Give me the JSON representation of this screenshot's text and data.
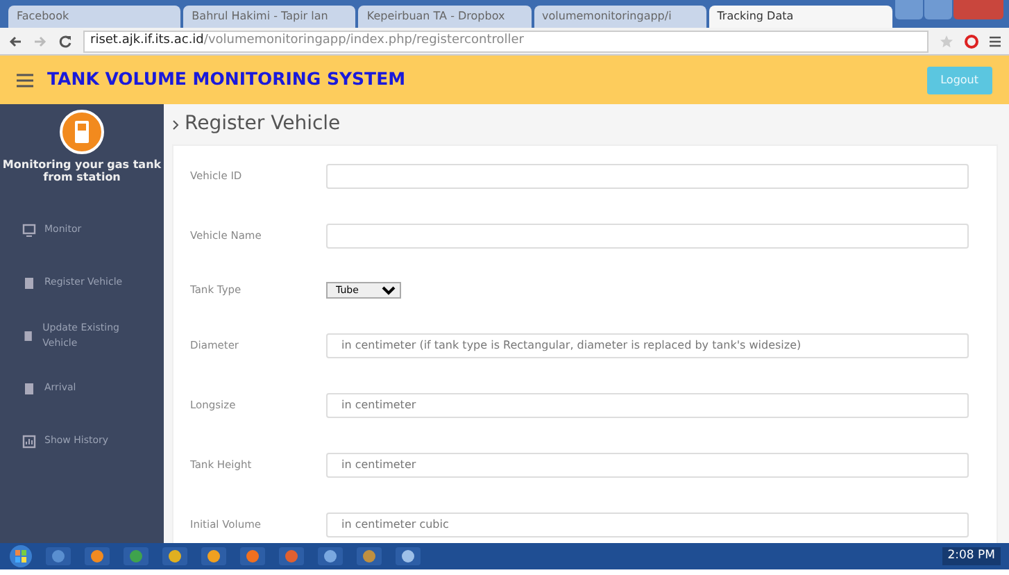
{
  "browser": {
    "tabs": [
      {
        "label": "Facebook",
        "selected": false
      },
      {
        "label": "Bahrul Hakimi - Tapir lan",
        "selected": false
      },
      {
        "label": "Kepeirbuan TA - Dropbox",
        "selected": false
      },
      {
        "label": "volumemonitoringapp/i",
        "selected": false
      },
      {
        "label": "Tracking Data",
        "selected": true
      }
    ],
    "url_host": "riset.ajk.if.its.ac.id",
    "url_path": "/volumemonitoringapp/index.php/registercontroller"
  },
  "navbar": {
    "title": "TANK VOLUME MONITORING SYSTEM",
    "button": "Logout"
  },
  "sidebar": {
    "tagline": "Monitoring your gas tank from station",
    "items": [
      {
        "label": "Monitor",
        "selected": false
      },
      {
        "label": "Register Vehicle",
        "selected": false
      },
      {
        "label": "Update Existing Vehicle",
        "selected": false
      },
      {
        "label": "Arrival",
        "selected": false
      },
      {
        "label": "Show History",
        "selected": false
      }
    ]
  },
  "page": {
    "title": "Register Vehicle",
    "fields": [
      {
        "kind": "text",
        "label": "Vehicle ID"
      },
      {
        "kind": "text",
        "label": "Vehicle Name"
      },
      {
        "kind": "select",
        "label": "Tank Type",
        "value": "Tube"
      },
      {
        "kind": "text",
        "label": "Diameter",
        "placeholder": "in centimeter (if tank type is Rectangular, diameter is replaced by tank's widesize)"
      },
      {
        "kind": "text",
        "label": "Longsize",
        "placeholder": "in centimeter"
      },
      {
        "kind": "text",
        "label": "Tank Height",
        "placeholder": "in centimeter"
      },
      {
        "kind": "text",
        "label": "Initial Volume",
        "placeholder": "in centimeter cubic"
      }
    ]
  },
  "taskbar": {
    "clock": "2:08 PM"
  }
}
